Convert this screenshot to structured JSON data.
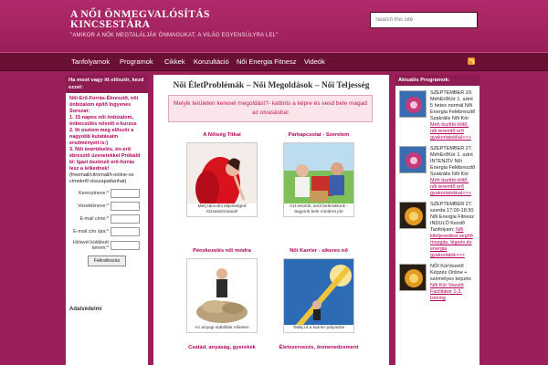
{
  "site": {
    "title": "A NŐI ÖNMEGVALÓSÍTÁS KINCSESTÁRA",
    "description": "\"AMIKOR A NŐK MEGTALÁLJÁK ÖNMAGUKAT, A VILÁG EGYENSÚLYRA LEL\""
  },
  "search": {
    "placeholder": "Search this site"
  },
  "nav": {
    "items": [
      "Tanfolyamok",
      "Programok",
      "Cikkek",
      "Konzultáció",
      "Női Energia Fitnesz",
      "Videók"
    ]
  },
  "left": {
    "heading": "Ha most vagy itt először, kezd ezzel:",
    "intro": "Női-Erő-Forrás-Ébresztő, női önbizalom építő Ingyenes Sorozat:",
    "item1": "1. 15 napos női önbizalom, önbecsülés növelő e-kurzus",
    "item2": "2. Itt osztom meg először a nagyobb kutatásaim eredményeit is:)",
    "item3": "3. Női önértékelés, én-erő ébresztő üzenetekkel Próbáld ki: Igazi öszönző erő-forrás lesz a lelkednek!",
    "note": "(freemail/citromail/t-online-os címekről visszapattanhat)",
    "form": {
      "first_name_label": "Keresztneve:",
      "last_name_label": "Vezetékneve:",
      "email_label": "E-mail címe:",
      "email2_label": "E-mail cím újra:",
      "consent_label": "Hírlevél küldését kérem:",
      "required_mark": "*",
      "submit": "Feliratkozás"
    },
    "footer": "Adatvédelmi"
  },
  "main": {
    "title": "Női ÉletProblémák – Női Megoldások – Női Teljesség",
    "notice": "Melyik területen keresel megoldást?- kattints a képre és vesd bele magad az olvasásba!",
    "cards": [
      {
        "title": "A Nőiség Titkai",
        "caption": "Merj táncolni teljességed rózsaszirmaival!"
      },
      {
        "title": "Párkapcsolat - Szerelem",
        "caption": "Azt esszük, amit beleraktunk - tegyünk bele mindent jót!"
      },
      {
        "title": "Pénzkezelés női módra",
        "caption": "Az anyagi stabilitás nőiesen"
      },
      {
        "title": "Női Karrier - sikeres nő",
        "caption": "Találj rá a karrier pályádra!"
      },
      {
        "title": "Család, anyaság, gyerekek",
        "caption": ""
      },
      {
        "title": "Életszervezés, önmenedzsment",
        "caption": ""
      }
    ]
  },
  "right": {
    "heading": "Aktuális Programok:",
    "programs": [
      {
        "text": "SZEPTEMBER 20. MéhErőKör 1. szint 5 hetes normál Női Energia Felébresztő Szakrális Női Kör ",
        "link": "Méh tisztító-töltő, női teremtő erő gyakorlatokkal>>>"
      },
      {
        "text": "SZEPTEMBER 27. MéhErőKör 1. szint INTENZÍV Női Energia Felébresztő Szakrális Női Kör ",
        "link": "Méh tisztító-töltő, női teremtő erő gyakorlatokkal>>>"
      },
      {
        "text": "SZEPTEMBER 27. szerda 17:00-18:30 Női Energia Fitnesz INDULÓ Kezdő Tanfolyam: ",
        "link": "Női kiteljesedést segítő mozgás, légzés és energia gyakorlatok>>>"
      },
      {
        "text": "NŐI KörVezető Képzés Online + személyes képzés ",
        "link": "Női Kör Vezető Facilitátor 1-3. tréning"
      }
    ]
  },
  "colors": {
    "header": "#b02a6b",
    "nav": "#6b1035",
    "accent": "#b3005c",
    "page": "#9b1f5a"
  }
}
